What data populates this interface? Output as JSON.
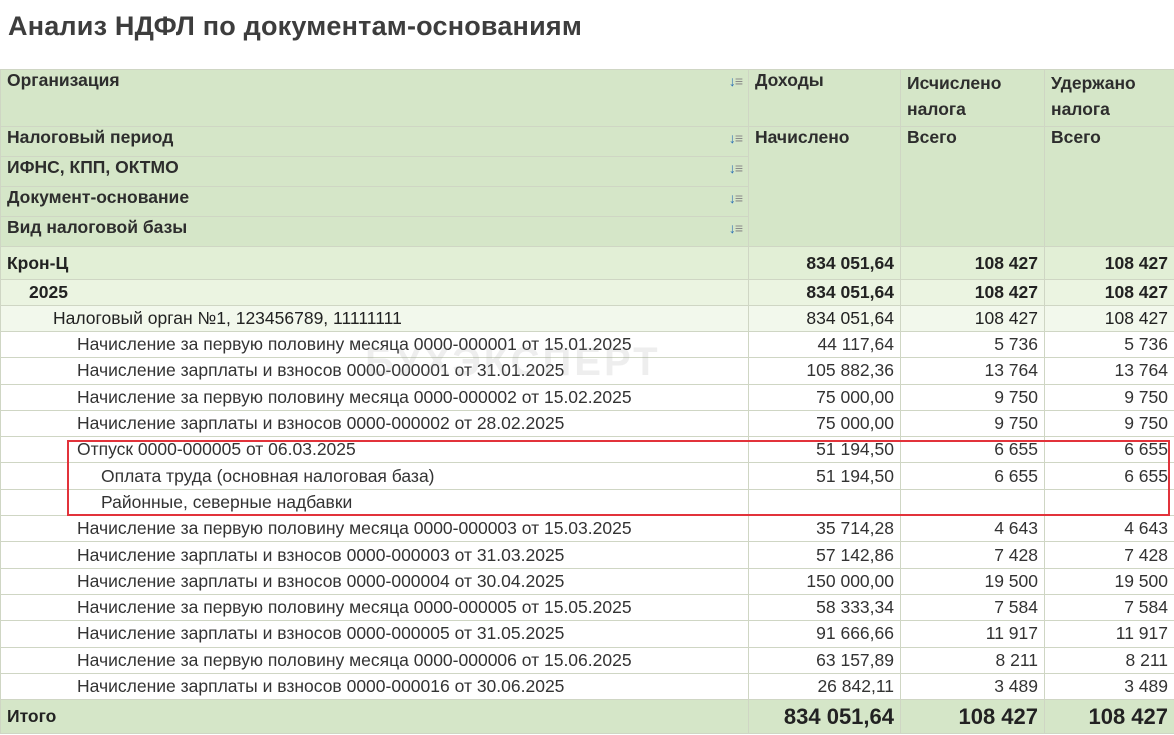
{
  "title": "Анализ НДФЛ по документам-основаниям",
  "watermark": "БУХЭКСПЕРТ",
  "header": {
    "groupings": [
      "Организация",
      "Налоговый период",
      "ИФНС, КПП, ОКТМО",
      "Документ-основание",
      "Вид налоговой базы"
    ],
    "col_income": "Доходы",
    "col_calc": "Исчислено налога",
    "col_withheld": "Удержано налога",
    "sub_income": "Начислено",
    "sub_calc": "Всего",
    "sub_withheld": "Всего"
  },
  "org": {
    "name": "Крон-Ц",
    "income": "834 051,64",
    "calc": "108 427",
    "withheld": "108 427"
  },
  "period": {
    "name": "2025",
    "income": "834 051,64",
    "calc": "108 427",
    "withheld": "108 427"
  },
  "tax_office": {
    "name": "Налоговый орган №1, 123456789, 11111111",
    "income": "834 051,64",
    "calc": "108 427",
    "withheld": "108 427"
  },
  "rows": [
    {
      "name": "Начисление за первую половину месяца 0000-000001 от 15.01.2025",
      "income": "44 117,64",
      "calc": "5 736",
      "withheld": "5 736"
    },
    {
      "name": "Начисление зарплаты и взносов 0000-000001 от 31.01.2025",
      "income": "105 882,36",
      "calc": "13 764",
      "withheld": "13 764"
    },
    {
      "name": "Начисление за первую половину месяца 0000-000002 от 15.02.2025",
      "income": "75 000,00",
      "calc": "9 750",
      "withheld": "9 750"
    },
    {
      "name": "Начисление зарплаты и взносов 0000-000002 от 28.02.2025",
      "income": "75 000,00",
      "calc": "9 750",
      "withheld": "9 750"
    },
    {
      "name": "Отпуск 0000-000005 от 06.03.2025",
      "income": "51 194,50",
      "calc": "6 655",
      "withheld": "6 655"
    },
    {
      "name": "Оплата труда (основная налоговая база)",
      "income": "51 194,50",
      "calc": "6 655",
      "withheld": "6 655"
    },
    {
      "name": "Районные, северные надбавки",
      "income": "",
      "calc": "",
      "withheld": ""
    },
    {
      "name": "Начисление за первую половину месяца 0000-000003 от 15.03.2025",
      "income": "35 714,28",
      "calc": "4 643",
      "withheld": "4 643"
    },
    {
      "name": "Начисление зарплаты и взносов 0000-000003 от 31.03.2025",
      "income": "57 142,86",
      "calc": "7 428",
      "withheld": "7 428"
    },
    {
      "name": "Начисление зарплаты и взносов 0000-000004 от 30.04.2025",
      "income": "150 000,00",
      "calc": "19 500",
      "withheld": "19 500"
    },
    {
      "name": "Начисление за первую половину месяца 0000-000005 от 15.05.2025",
      "income": "58 333,34",
      "calc": "7 584",
      "withheld": "7 584"
    },
    {
      "name": "Начисление зарплаты и взносов 0000-000005 от 31.05.2025",
      "income": "91 666,66",
      "calc": "11 917",
      "withheld": "11 917"
    },
    {
      "name": "Начисление за первую половину месяца 0000-000006 от 15.06.2025",
      "income": "63 157,89",
      "calc": "8 211",
      "withheld": "8 211"
    },
    {
      "name": "Начисление зарплаты и взносов 0000-000016 от 30.06.2025",
      "income": "26 842,11",
      "calc": "3 489",
      "withheld": "3 489"
    }
  ],
  "total": {
    "label": "Итого",
    "income": "834 051,64",
    "calc": "108 427",
    "withheld": "108 427"
  },
  "colors": {
    "header_bg": "#d5e6c8",
    "highlight": "#e2333b",
    "title": "#3d3d3d"
  }
}
